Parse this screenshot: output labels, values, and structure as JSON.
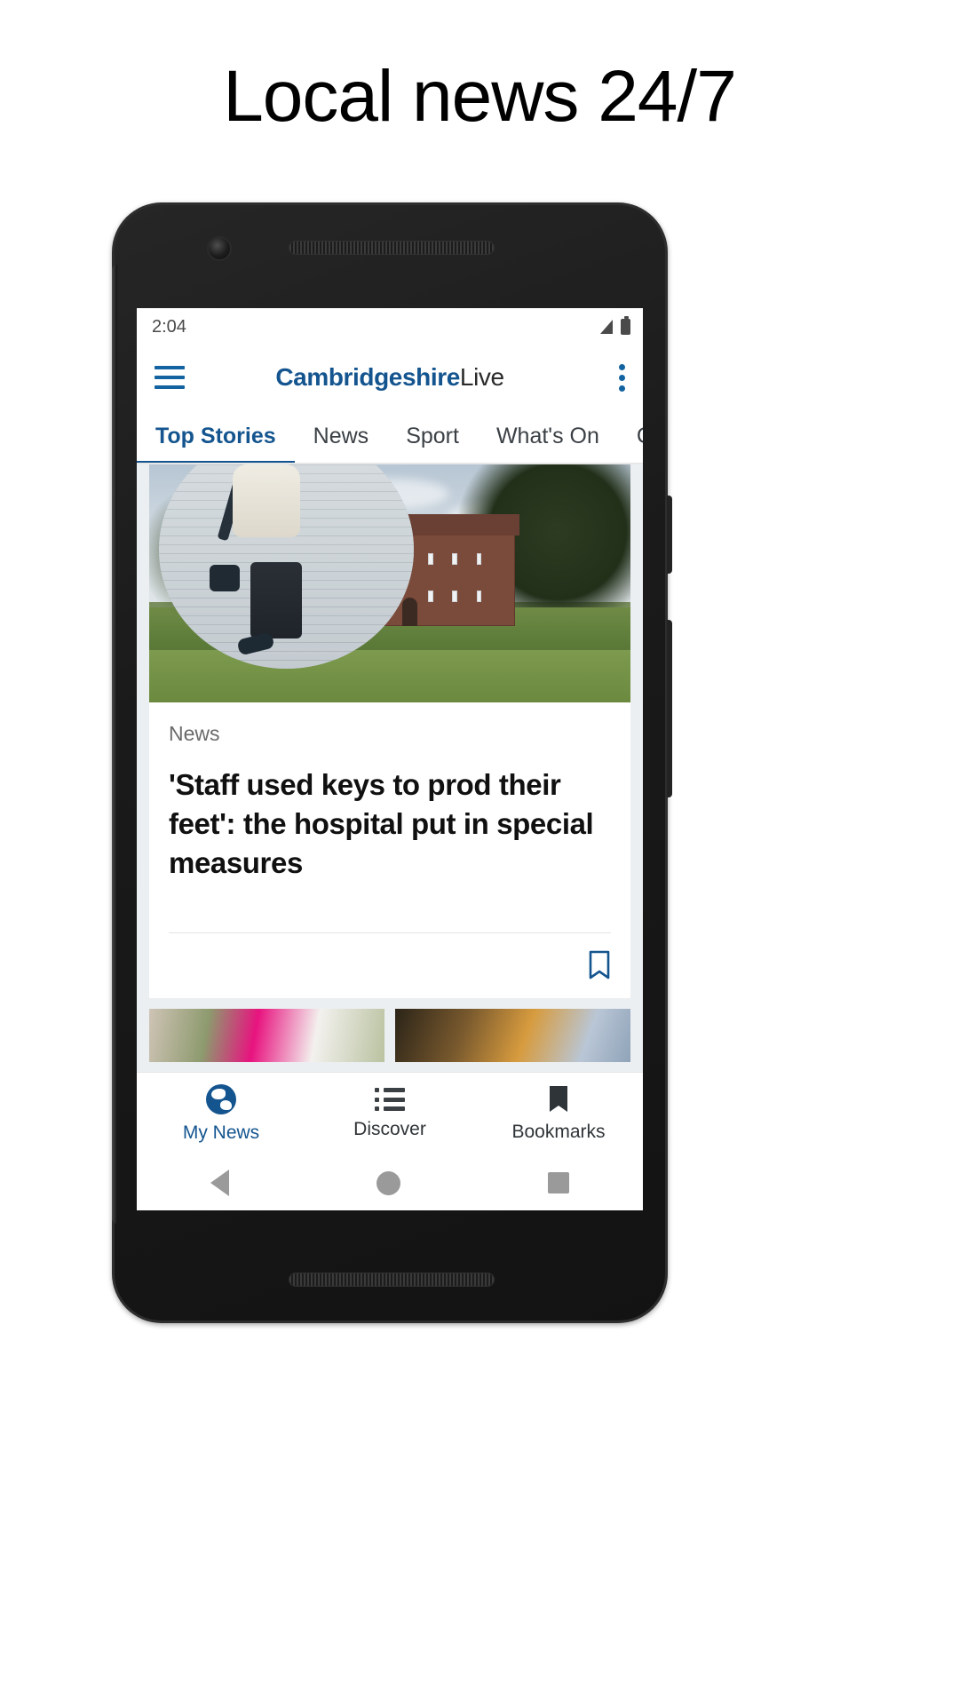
{
  "promo": {
    "heading": "Local news 24/7"
  },
  "phone": {
    "statusbar": {
      "time": "2:04",
      "signal_icon": "signal-bars-icon",
      "battery_icon": "battery-full-icon"
    },
    "appbar": {
      "menu_icon": "hamburger-menu-icon",
      "brand_primary": "Cambridgeshire",
      "brand_secondary": "Live",
      "overflow_icon": "more-vertical-icon"
    },
    "tabs": [
      {
        "label": "Top Stories",
        "active": true
      },
      {
        "label": "News",
        "active": false
      },
      {
        "label": "Sport",
        "active": false
      },
      {
        "label": "What's On",
        "active": false
      },
      {
        "label": "Cambridge",
        "active": false
      }
    ],
    "article": {
      "kicker": "News",
      "headline": "'Staff used keys to prod their feet': the hospital put in special measures",
      "bookmark_icon": "bookmark-outline-icon"
    },
    "bottom_nav": [
      {
        "label": "My News",
        "icon": "globe-icon",
        "active": true
      },
      {
        "label": "Discover",
        "icon": "list-icon",
        "active": false
      },
      {
        "label": "Bookmarks",
        "icon": "bookmark-filled-icon",
        "active": false
      }
    ],
    "system_nav": {
      "back_icon": "triangle-back-icon",
      "home_icon": "circle-home-icon",
      "recents_icon": "square-recents-icon"
    }
  },
  "colors": {
    "brand_blue": "#14558f",
    "accent_blue": "#1263a0",
    "text_dark": "#101010",
    "text_muted": "#6b6b6b",
    "feed_bg": "#eceff1"
  }
}
